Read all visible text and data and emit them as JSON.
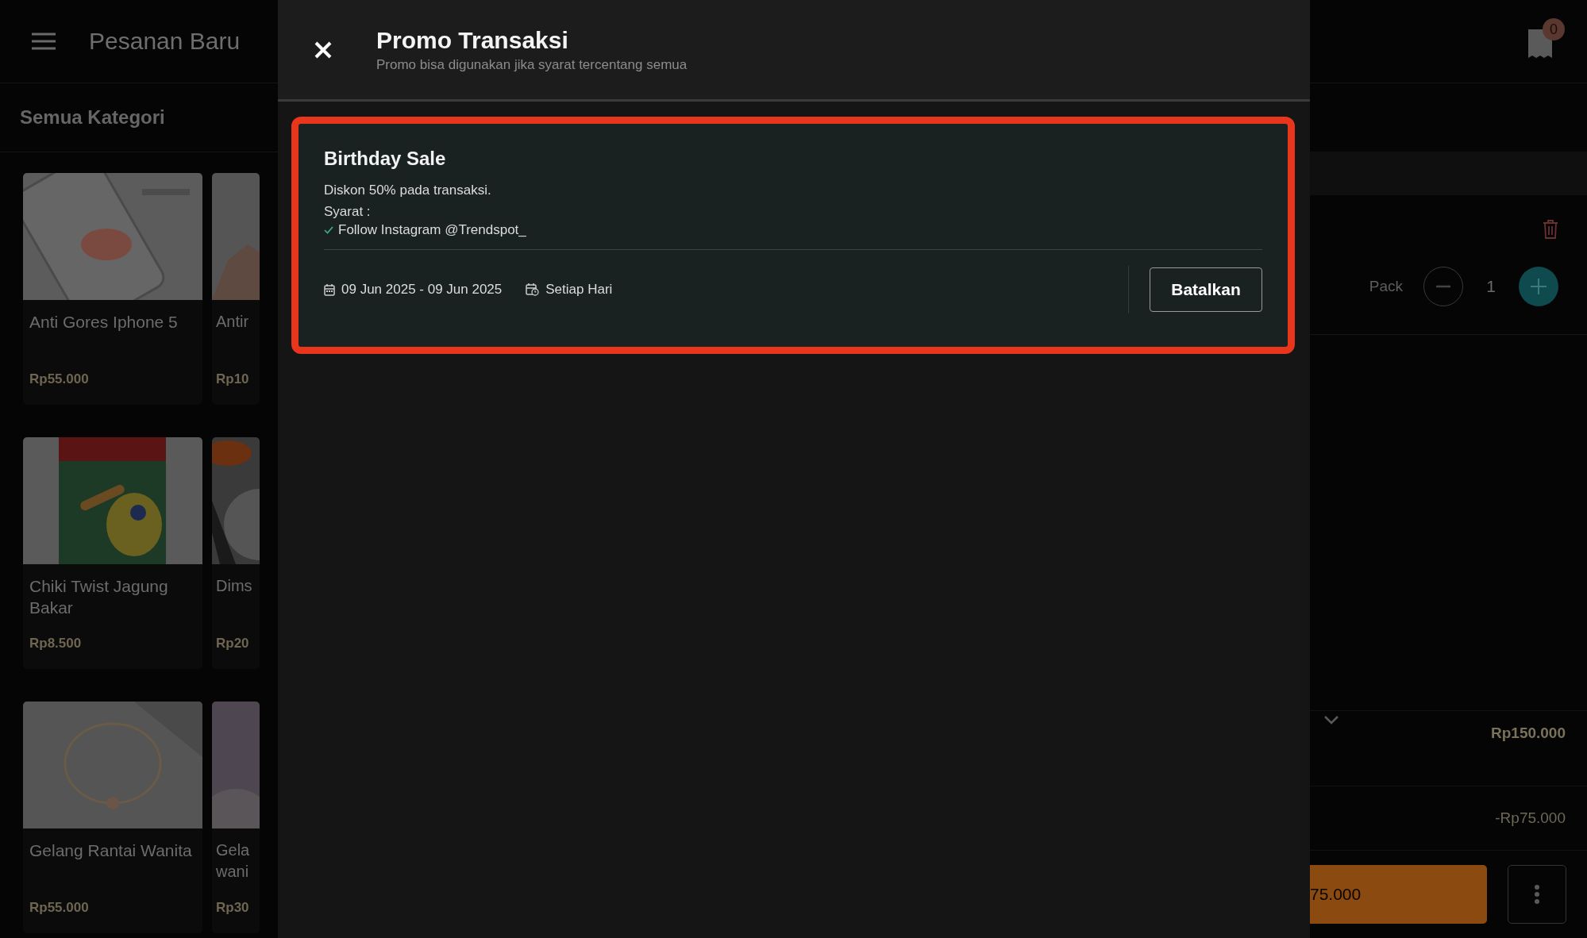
{
  "header": {
    "title": "Pesanan Baru"
  },
  "category": {
    "title": "Semua Kategori"
  },
  "products": [
    {
      "name": "Anti Gores Iphone 5",
      "price": "Rp55.000",
      "kind": "phone"
    },
    {
      "name": "Chiki Twist Jagung Bakar",
      "price": "Rp8.500",
      "kind": "snack"
    },
    {
      "name": "Gelang Rantai Wanita",
      "price": "Rp55.000",
      "kind": "bracelet"
    }
  ],
  "products_partial": [
    {
      "name": "Antir",
      "price": "Rp10",
      "kind": "hand"
    },
    {
      "name": "Dims",
      "price": "Rp20",
      "kind": "food"
    },
    {
      "name": "Gela wani",
      "price": "Rp30",
      "kind": "pink"
    }
  ],
  "cart": {
    "badge": "0",
    "unit": "Pack",
    "quantity": "1",
    "subtotal": "Rp150.000",
    "discount": "-Rp75.000",
    "pay_button": "75.000"
  },
  "modal": {
    "title": "Promo Transaksi",
    "subtitle": "Promo bisa digunakan jika syarat tercentang semua",
    "promos": [
      {
        "name": "Birthday Sale",
        "description": "Diskon 50% pada transaksi.",
        "terms_label": "Syarat :",
        "terms": [
          {
            "text": "Follow Instagram @Trendspot_",
            "checked": true
          }
        ],
        "period": "09 Jun 2025 - 09 Jun 2025",
        "schedule": "Setiap Hari",
        "action": "Batalkan",
        "highlighted": true
      }
    ]
  }
}
